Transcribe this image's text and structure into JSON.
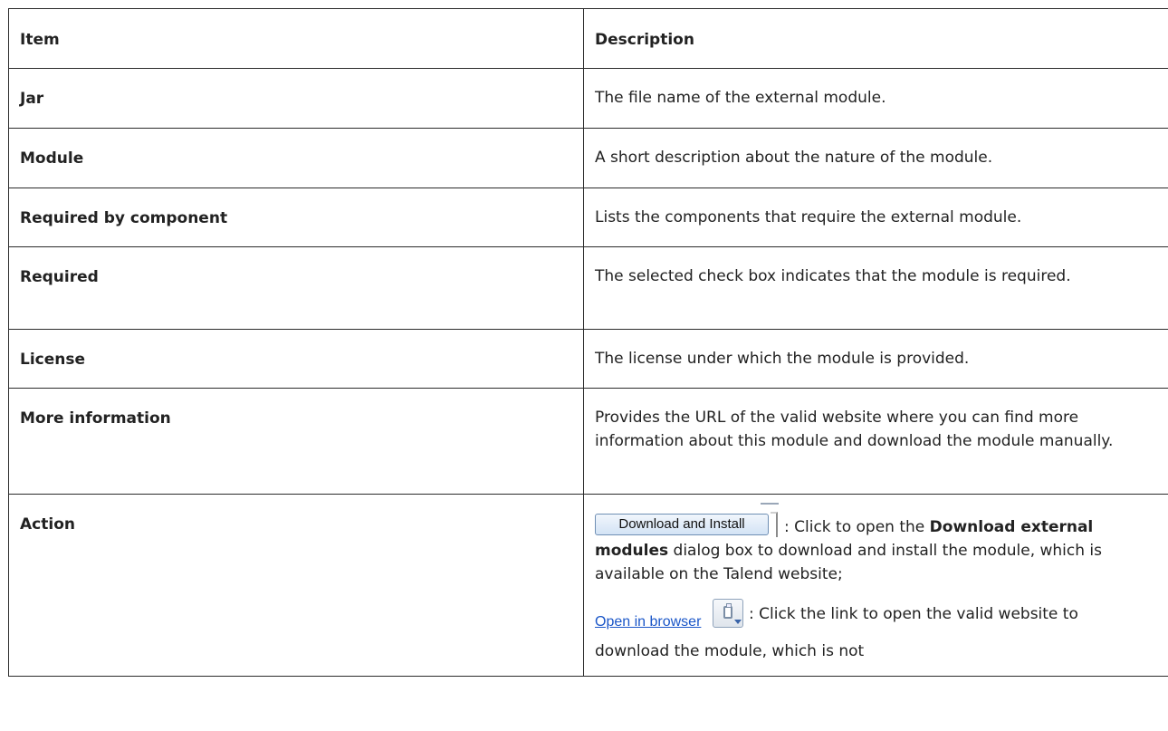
{
  "table": {
    "header": {
      "item": "Item",
      "description": "Description"
    },
    "rows": [
      {
        "item": "Jar",
        "description": "The file name of the external module."
      },
      {
        "item": "Module",
        "description": "A short description about the nature of the module."
      },
      {
        "item": "Required by component",
        "description": "Lists the components that require the external module."
      },
      {
        "item": "Required",
        "description": "The selected check box indicates that the module is required."
      },
      {
        "item": "License",
        "description": "The license under which the module is provided."
      },
      {
        "item": "More information",
        "description": "Provides the URL of the valid website where you can find more information about this module and download the module manually."
      }
    ],
    "action_row": {
      "item": "Action",
      "download_button_label": "Download and Install",
      "p1_prefix": ": Click to open the ",
      "p1_bold": "Download external modules",
      "p1_suffix": " dialog box to download and install the module, which is available on the Talend website;",
      "open_link_label": "Open in browser",
      "icon": "jar-download-icon",
      "p2_text": ": Click the link to open the valid website to download the module, which is not"
    }
  }
}
